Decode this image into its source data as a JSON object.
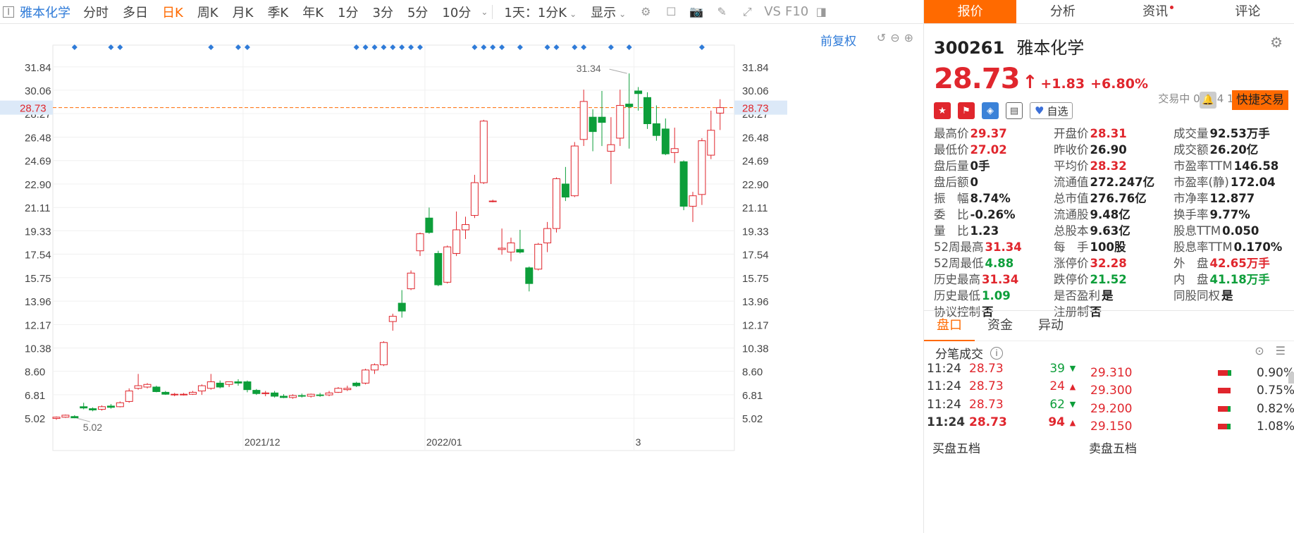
{
  "toolbar": {
    "stock_name": "雅本化学",
    "periods": [
      "分时",
      "多日",
      "日K",
      "周K",
      "月K",
      "季K",
      "年K",
      "1分",
      "3分",
      "5分",
      "10分"
    ],
    "active_period": "日K",
    "multi_period": "1天：1分K",
    "display": "显示",
    "vs_label": "VS",
    "f10_label": "F10"
  },
  "chart": {
    "fuquan_label": "前复权",
    "accent_color": "#ff6a00",
    "up_color": "#e0262d",
    "down_color": "#0d9e3a"
  },
  "chart_data": {
    "type": "candlestick",
    "y_ticks": [
      "31.84",
      "30.06",
      "28.27",
      "26.48",
      "24.69",
      "22.90",
      "21.11",
      "19.33",
      "17.54",
      "15.75",
      "13.96",
      "12.17",
      "10.38",
      "8.60",
      "6.81",
      "5.02"
    ],
    "ylim": [
      3.9,
      33.5
    ],
    "x_labels": [
      {
        "label": "2021/12",
        "index": 21
      },
      {
        "label": "2022/01",
        "index": 41
      },
      {
        "label": "3",
        "index": 64
      }
    ],
    "current_price": "28.73",
    "annotations": [
      {
        "text": "31.34",
        "index": 63,
        "value": 31.34,
        "kind": "high"
      },
      {
        "text": "5.02",
        "index": 2,
        "value": 5.02,
        "kind": "low"
      }
    ],
    "event_markers": [
      2,
      6,
      7,
      17,
      20,
      21,
      33,
      34,
      35,
      36,
      37,
      38,
      39,
      40,
      46,
      47,
      48,
      49,
      51,
      54,
      55,
      57,
      58,
      61,
      63,
      71
    ],
    "candles": [
      {
        "o": 5.0,
        "h": 5.15,
        "l": 4.9,
        "c": 5.1
      },
      {
        "o": 5.1,
        "h": 5.3,
        "l": 5.05,
        "c": 5.25
      },
      {
        "o": 5.15,
        "h": 5.25,
        "l": 5.02,
        "c": 5.05
      },
      {
        "o": 5.9,
        "h": 6.2,
        "l": 5.7,
        "c": 5.8
      },
      {
        "o": 5.75,
        "h": 5.85,
        "l": 5.55,
        "c": 5.65
      },
      {
        "o": 5.7,
        "h": 6.0,
        "l": 5.6,
        "c": 5.9
      },
      {
        "o": 5.95,
        "h": 6.1,
        "l": 5.75,
        "c": 5.85
      },
      {
        "o": 5.9,
        "h": 6.3,
        "l": 5.85,
        "c": 6.2
      },
      {
        "o": 6.3,
        "h": 7.3,
        "l": 6.2,
        "c": 7.1
      },
      {
        "o": 7.3,
        "h": 8.4,
        "l": 7.2,
        "c": 7.5
      },
      {
        "o": 7.4,
        "h": 7.7,
        "l": 7.3,
        "c": 7.6
      },
      {
        "o": 7.4,
        "h": 7.5,
        "l": 7.0,
        "c": 7.05
      },
      {
        "o": 7.0,
        "h": 7.1,
        "l": 6.8,
        "c": 6.85
      },
      {
        "o": 6.8,
        "h": 6.95,
        "l": 6.7,
        "c": 6.85
      },
      {
        "o": 6.85,
        "h": 6.95,
        "l": 6.75,
        "c": 6.85
      },
      {
        "o": 6.85,
        "h": 7.1,
        "l": 6.8,
        "c": 7.0
      },
      {
        "o": 7.1,
        "h": 7.6,
        "l": 6.8,
        "c": 7.5
      },
      {
        "o": 7.3,
        "h": 8.4,
        "l": 7.2,
        "c": 7.8
      },
      {
        "o": 7.7,
        "h": 7.9,
        "l": 7.3,
        "c": 7.4
      },
      {
        "o": 7.6,
        "h": 7.8,
        "l": 7.4,
        "c": 7.8
      },
      {
        "o": 7.8,
        "h": 8.0,
        "l": 7.5,
        "c": 7.7
      },
      {
        "o": 7.8,
        "h": 7.9,
        "l": 7.0,
        "c": 7.2
      },
      {
        "o": 7.15,
        "h": 7.25,
        "l": 6.8,
        "c": 6.9
      },
      {
        "o": 6.95,
        "h": 7.1,
        "l": 6.7,
        "c": 6.95
      },
      {
        "o": 6.95,
        "h": 7.1,
        "l": 6.6,
        "c": 6.7
      },
      {
        "o": 6.7,
        "h": 6.85,
        "l": 6.55,
        "c": 6.6
      },
      {
        "o": 6.6,
        "h": 6.85,
        "l": 6.5,
        "c": 6.75
      },
      {
        "o": 6.75,
        "h": 6.9,
        "l": 6.6,
        "c": 6.7
      },
      {
        "o": 6.7,
        "h": 6.9,
        "l": 6.6,
        "c": 6.85
      },
      {
        "o": 6.8,
        "h": 6.95,
        "l": 6.65,
        "c": 6.75
      },
      {
        "o": 6.8,
        "h": 7.1,
        "l": 6.7,
        "c": 6.95
      },
      {
        "o": 7.0,
        "h": 7.4,
        "l": 6.95,
        "c": 7.3
      },
      {
        "o": 7.2,
        "h": 7.5,
        "l": 7.1,
        "c": 7.3
      },
      {
        "o": 7.7,
        "h": 7.8,
        "l": 7.4,
        "c": 7.5
      },
      {
        "o": 7.7,
        "h": 8.8,
        "l": 7.6,
        "c": 8.7
      },
      {
        "o": 8.7,
        "h": 9.2,
        "l": 8.4,
        "c": 9.1
      },
      {
        "o": 9.1,
        "h": 10.9,
        "l": 9.0,
        "c": 10.8
      },
      {
        "o": 12.4,
        "h": 13.0,
        "l": 11.7,
        "c": 12.8
      },
      {
        "o": 13.8,
        "h": 14.8,
        "l": 12.7,
        "c": 13.2
      },
      {
        "o": 14.9,
        "h": 16.3,
        "l": 14.8,
        "c": 16.1
      },
      {
        "o": 17.8,
        "h": 19.2,
        "l": 17.4,
        "c": 19.1
      },
      {
        "o": 20.3,
        "h": 21.1,
        "l": 19.1,
        "c": 19.2
      },
      {
        "o": 17.6,
        "h": 17.8,
        "l": 15.1,
        "c": 15.2
      },
      {
        "o": 15.4,
        "h": 18.2,
        "l": 15.3,
        "c": 18.1
      },
      {
        "o": 17.6,
        "h": 20.8,
        "l": 17.4,
        "c": 19.4
      },
      {
        "o": 19.4,
        "h": 20.4,
        "l": 18.7,
        "c": 19.8
      },
      {
        "o": 20.5,
        "h": 23.6,
        "l": 20.3,
        "c": 23.0
      },
      {
        "o": 23.0,
        "h": 27.8,
        "l": 22.9,
        "c": 27.7
      },
      {
        "o": 21.6,
        "h": 21.7,
        "l": 21.5,
        "c": 21.6
      },
      {
        "o": 17.9,
        "h": 19.5,
        "l": 17.5,
        "c": 18.0
      },
      {
        "o": 17.7,
        "h": 18.8,
        "l": 17.0,
        "c": 18.4
      },
      {
        "o": 17.9,
        "h": 19.4,
        "l": 17.6,
        "c": 17.7
      },
      {
        "o": 16.5,
        "h": 16.6,
        "l": 14.7,
        "c": 15.3
      },
      {
        "o": 16.4,
        "h": 18.4,
        "l": 16.3,
        "c": 18.3
      },
      {
        "o": 18.4,
        "h": 20.0,
        "l": 17.7,
        "c": 19.5
      },
      {
        "o": 19.5,
        "h": 23.4,
        "l": 19.2,
        "c": 23.3
      },
      {
        "o": 22.9,
        "h": 24.2,
        "l": 21.6,
        "c": 21.9
      },
      {
        "o": 22.0,
        "h": 26.1,
        "l": 21.9,
        "c": 25.8
      },
      {
        "o": 26.3,
        "h": 30.1,
        "l": 25.8,
        "c": 29.2
      },
      {
        "o": 28.0,
        "h": 28.6,
        "l": 25.4,
        "c": 26.9
      },
      {
        "o": 28.0,
        "h": 30.0,
        "l": 25.8,
        "c": 27.6
      },
      {
        "o": 25.4,
        "h": 28.0,
        "l": 22.9,
        "c": 25.9
      },
      {
        "o": 26.4,
        "h": 30.1,
        "l": 25.8,
        "c": 28.9
      },
      {
        "o": 29.0,
        "h": 31.34,
        "l": 25.6,
        "c": 28.8
      },
      {
        "o": 30.0,
        "h": 30.3,
        "l": 28.5,
        "c": 29.8
      },
      {
        "o": 29.5,
        "h": 29.9,
        "l": 27.1,
        "c": 27.5
      },
      {
        "o": 27.5,
        "h": 28.9,
        "l": 26.2,
        "c": 26.6
      },
      {
        "o": 27.1,
        "h": 27.9,
        "l": 25.1,
        "c": 25.2
      },
      {
        "o": 25.3,
        "h": 27.2,
        "l": 24.5,
        "c": 25.6
      },
      {
        "o": 24.6,
        "h": 24.7,
        "l": 20.9,
        "c": 21.2
      },
      {
        "o": 21.2,
        "h": 22.3,
        "l": 20.0,
        "c": 22.0
      },
      {
        "o": 22.1,
        "h": 26.4,
        "l": 21.3,
        "c": 26.2
      },
      {
        "o": 25.1,
        "h": 28.5,
        "l": 24.8,
        "c": 27.0
      },
      {
        "o": 28.31,
        "h": 29.37,
        "l": 27.02,
        "c": 28.73
      }
    ]
  },
  "right": {
    "tabs": [
      "报价",
      "分析",
      "资讯",
      "评论"
    ],
    "active_tab": "报价",
    "code": "300261",
    "name": "雅本化学",
    "price": "28.73",
    "change": "+1.83",
    "change_pct": "+6.80%",
    "trade_time": "交易中 03/14 11:24(北京)",
    "watch_label": "自选",
    "quick_trade": "快捷交易",
    "metrics": [
      [
        {
          "label": "最高价",
          "value": "29.37",
          "color": "red"
        },
        {
          "label": "开盘价",
          "value": "28.31",
          "color": "red"
        },
        {
          "label": "成交量",
          "value": "92.53万手",
          "color": ""
        }
      ],
      [
        {
          "label": "最低价",
          "value": "27.02",
          "color": "red"
        },
        {
          "label": "昨收价",
          "value": "26.90",
          "color": ""
        },
        {
          "label": "成交额",
          "value": "26.20亿",
          "color": ""
        }
      ],
      [
        {
          "label": "盘后量",
          "value": "0手",
          "color": ""
        },
        {
          "label": "平均价",
          "value": "28.32",
          "color": "red"
        },
        {
          "label": "市盈率TTM",
          "value": "146.58",
          "color": ""
        }
      ],
      [
        {
          "label": "盘后额",
          "value": "0",
          "color": ""
        },
        {
          "label": "流通值",
          "value": "272.247亿",
          "color": ""
        },
        {
          "label": "市盈率(静)",
          "value": "172.04",
          "color": ""
        }
      ],
      [
        {
          "label": "振　幅",
          "value": "8.74%",
          "color": ""
        },
        {
          "label": "总市值",
          "value": "276.76亿",
          "color": ""
        },
        {
          "label": "市净率",
          "value": "12.877",
          "color": ""
        }
      ],
      [
        {
          "label": "委　比",
          "value": "-0.26%",
          "color": ""
        },
        {
          "label": "流通股",
          "value": "9.48亿",
          "color": ""
        },
        {
          "label": "换手率",
          "value": "9.77%",
          "color": ""
        }
      ],
      [
        {
          "label": "量　比",
          "value": "1.23",
          "color": ""
        },
        {
          "label": "总股本",
          "value": "9.63亿",
          "color": ""
        },
        {
          "label": "股息TTM",
          "value": "0.050",
          "color": ""
        }
      ],
      [
        {
          "label": "52周最高",
          "value": "31.34",
          "color": "red"
        },
        {
          "label": "每　手",
          "value": "100股",
          "color": ""
        },
        {
          "label": "股息率TTM",
          "value": "0.170%",
          "color": ""
        }
      ],
      [
        {
          "label": "52周最低",
          "value": "4.88",
          "color": "green"
        },
        {
          "label": "涨停价",
          "value": "32.28",
          "color": "red"
        },
        {
          "label": "外　盘",
          "value": "42.65万手",
          "color": "red"
        }
      ],
      [
        {
          "label": "历史最高",
          "value": "31.34",
          "color": "red"
        },
        {
          "label": "跌停价",
          "value": "21.52",
          "color": "green"
        },
        {
          "label": "内　盘",
          "value": "41.18万手",
          "color": "green"
        }
      ],
      [
        {
          "label": "历史最低",
          "value": "1.09",
          "color": "green"
        },
        {
          "label": "是否盈利",
          "value": "是",
          "color": ""
        },
        {
          "label": "同股同权",
          "value": "是",
          "color": ""
        }
      ],
      [
        {
          "label": "协议控制",
          "value": "否",
          "color": ""
        },
        {
          "label": "注册制",
          "value": "否",
          "color": ""
        },
        {
          "label": "",
          "value": "",
          "color": ""
        }
      ]
    ],
    "bottom_tabs": [
      "盘口",
      "资金",
      "异动"
    ],
    "active_bottom_tab": "盘口",
    "fenbi_title": "分笔成交",
    "ticks": [
      {
        "time": "11:24",
        "price": "28.73",
        "vol": "39",
        "dir": "down"
      },
      {
        "time": "11:24",
        "price": "28.73",
        "vol": "24",
        "dir": "up"
      },
      {
        "time": "11:24",
        "price": "28.73",
        "vol": "62",
        "dir": "down"
      },
      {
        "time": "11:24",
        "price": "28.73",
        "vol": "94",
        "dir": "up"
      }
    ],
    "levels": [
      {
        "price": "29.310",
        "pct": "0.90%",
        "red": 0.75,
        "green": 0.25
      },
      {
        "price": "29.300",
        "pct": "0.75%",
        "red": 1.0,
        "green": 0.0
      },
      {
        "price": "29.200",
        "pct": "0.82%",
        "red": 0.8,
        "green": 0.2
      },
      {
        "price": "29.150",
        "pct": "1.08%",
        "red": 0.7,
        "green": 0.3
      }
    ],
    "buy_five": "买盘五档",
    "sell_five": "卖盘五档"
  }
}
